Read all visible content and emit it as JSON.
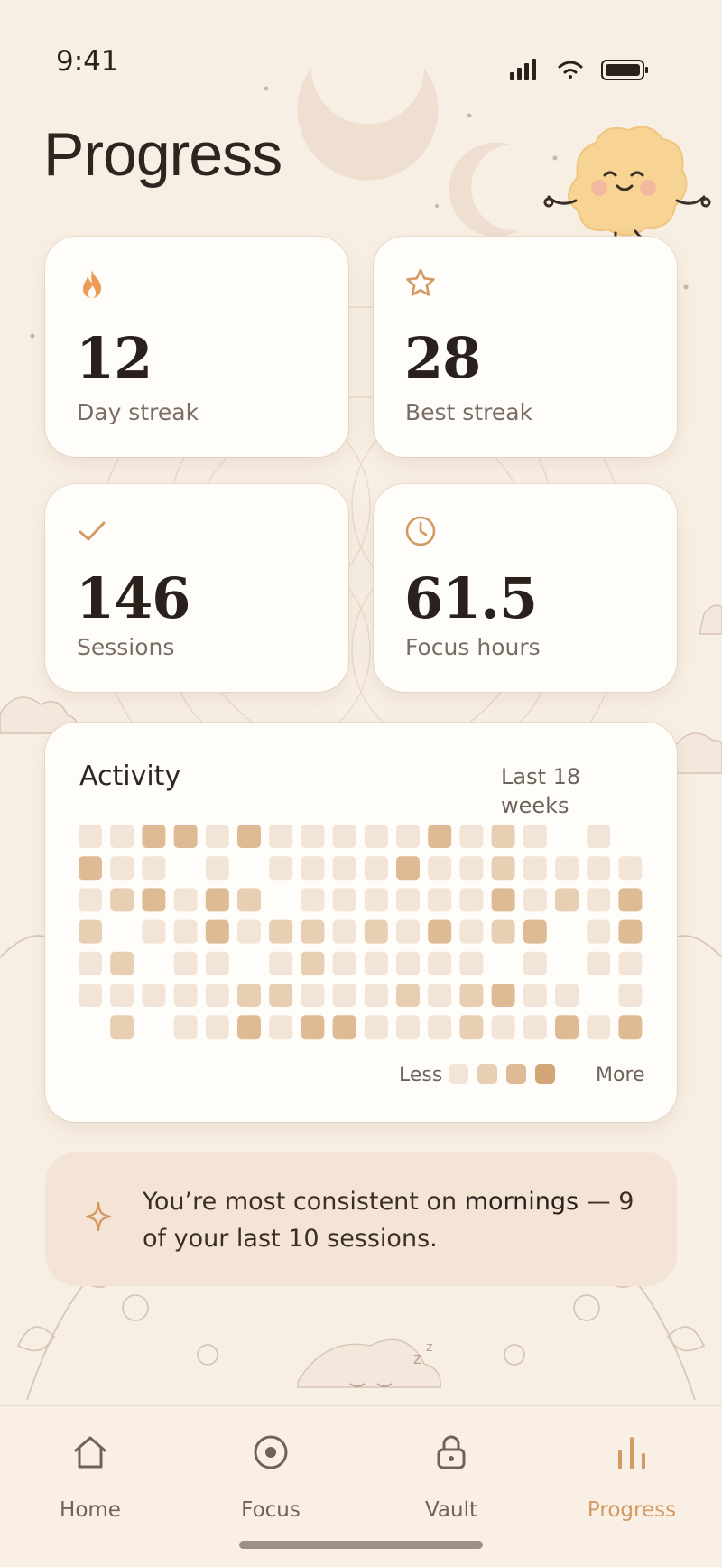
{
  "status_bar": {
    "time": "9:41"
  },
  "page_title": "Progress",
  "stats": [
    {
      "icon": "flame-icon",
      "value": "12",
      "label": "Day streak"
    },
    {
      "icon": "star-icon",
      "value": "28",
      "label": "Best streak"
    },
    {
      "icon": "check-icon",
      "value": "146",
      "label": "Sessions"
    },
    {
      "icon": "clock-icon",
      "value": "61.5",
      "label": "Focus hours"
    }
  ],
  "activity": {
    "title": "Activity",
    "range": "Last 18 weeks",
    "legend_less": "Less",
    "legend_more": "More",
    "levels": [
      "#f2e4d6",
      "#e8cfb3",
      "#dfbb95",
      "#d3a677"
    ],
    "grid": [
      [
        1,
        1,
        3,
        3,
        1,
        3,
        1,
        1,
        1,
        1,
        1,
        3,
        1,
        2,
        1,
        0,
        1,
        0
      ],
      [
        3,
        1,
        1,
        0,
        1,
        0,
        1,
        1,
        1,
        1,
        3,
        1,
        1,
        2,
        1,
        1,
        1,
        1
      ],
      [
        1,
        2,
        3,
        1,
        3,
        2,
        0,
        1,
        1,
        1,
        1,
        1,
        1,
        3,
        1,
        2,
        1,
        3
      ],
      [
        2,
        0,
        1,
        1,
        3,
        1,
        2,
        2,
        1,
        2,
        1,
        3,
        1,
        2,
        3,
        0,
        1,
        3
      ],
      [
        1,
        2,
        0,
        1,
        1,
        0,
        1,
        2,
        1,
        1,
        1,
        1,
        1,
        0,
        1,
        0,
        1,
        1
      ],
      [
        1,
        1,
        1,
        1,
        1,
        2,
        2,
        1,
        1,
        1,
        2,
        1,
        2,
        3,
        1,
        1,
        0,
        1
      ],
      [
        0,
        2,
        0,
        1,
        1,
        3,
        1,
        3,
        3,
        1,
        1,
        1,
        2,
        1,
        1,
        3,
        1,
        3
      ]
    ]
  },
  "insight": {
    "before": "You’re most consistent on ",
    "highlight": "mornings",
    "after": " — 9 of your last 10 sessions."
  },
  "tabs": [
    {
      "icon": "home-icon",
      "label": "Home",
      "active": false
    },
    {
      "icon": "focus-icon",
      "label": "Focus",
      "active": false
    },
    {
      "icon": "lock-icon",
      "label": "Vault",
      "active": false
    },
    {
      "icon": "bar-chart-icon",
      "label": "Progress",
      "active": true
    }
  ],
  "colors": {
    "background": "#f8efe4",
    "accent": "#d39a63",
    "flame": "#ec9a55",
    "card": "#fffdfa",
    "insight_bg": "#f3e4d5"
  }
}
